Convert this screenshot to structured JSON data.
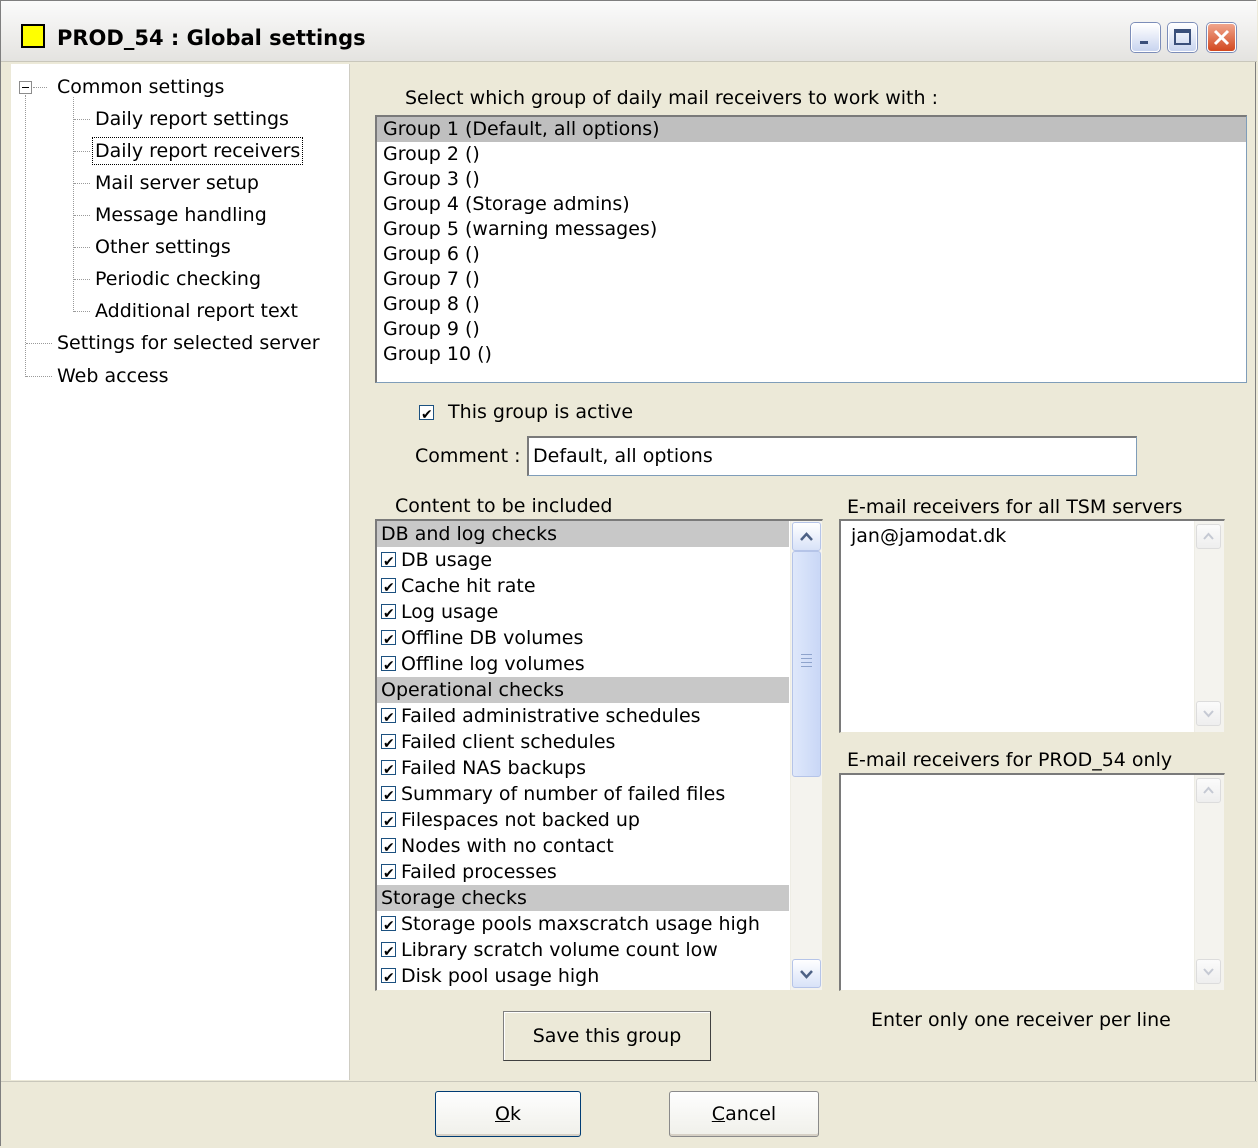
{
  "window": {
    "title": "PROD_54 : Global settings"
  },
  "tree": {
    "root": "Common settings",
    "children": [
      "Daily report settings",
      "Daily report receivers",
      "Mail server setup",
      "Message handling",
      "Other settings",
      "Periodic checking",
      "Additional report text"
    ],
    "siblings": [
      "Settings for selected server",
      "Web access"
    ],
    "selected": "Daily report receivers"
  },
  "group_select": {
    "prompt": "Select which group of daily mail receivers to work with :",
    "groups": [
      "Group 1 (Default, all options)",
      "Group 2 ()",
      "Group 3 ()",
      "Group 4 (Storage admins)",
      "Group 5 (warning messages)",
      "Group 6 ()",
      "Group 7 ()",
      "Group 8 ()",
      "Group 9 ()",
      "Group 10 ()"
    ],
    "selected_index": 0
  },
  "active_checkbox": {
    "label": "This group is active",
    "checked": true
  },
  "comment": {
    "label": "Comment :",
    "value": "Default, all options"
  },
  "content": {
    "header": "Content to be included",
    "rows": [
      {
        "text": "DB and log checks",
        "group": true
      },
      {
        "text": "DB usage",
        "checked": true
      },
      {
        "text": "Cache hit rate",
        "checked": true
      },
      {
        "text": "Log usage",
        "checked": true
      },
      {
        "text": "Offline DB volumes",
        "checked": true
      },
      {
        "text": "Offline log volumes",
        "checked": true
      },
      {
        "text": "Operational checks",
        "group": true
      },
      {
        "text": "Failed administrative schedules",
        "checked": true
      },
      {
        "text": "Failed client schedules",
        "checked": true
      },
      {
        "text": "Failed NAS backups",
        "checked": true
      },
      {
        "text": "Summary of number of failed files",
        "checked": true
      },
      {
        "text": "Filespaces not backed up",
        "checked": true
      },
      {
        "text": "Nodes with no contact",
        "checked": true
      },
      {
        "text": "Failed processes",
        "checked": true
      },
      {
        "text": "Storage checks",
        "group": true
      },
      {
        "text": "Storage pools maxscratch usage high",
        "checked": true
      },
      {
        "text": "Library scratch volume count low",
        "checked": true
      },
      {
        "text": "Disk pool usage high",
        "checked": true
      }
    ]
  },
  "receivers_all": {
    "label": "E-mail receivers for all TSM servers",
    "value": "jan@jamodat.dk"
  },
  "receivers_server": {
    "label": "E-mail receivers for PROD_54 only",
    "value": ""
  },
  "hint": "Enter only one receiver per line",
  "buttons": {
    "save_group": "Save this group",
    "ok_prefix": "",
    "ok_underlined": "O",
    "ok_rest": "k",
    "cancel_underlined": "C",
    "cancel_rest": "ancel"
  },
  "icons": {
    "minimize": "minimize-icon",
    "maximize": "maximize-icon",
    "close": "close-icon"
  },
  "colors": {
    "app_icon": "#ffff00",
    "close_button": "#d24820",
    "selection": "#bfbfbf",
    "group_row": "#c8c8c8"
  }
}
